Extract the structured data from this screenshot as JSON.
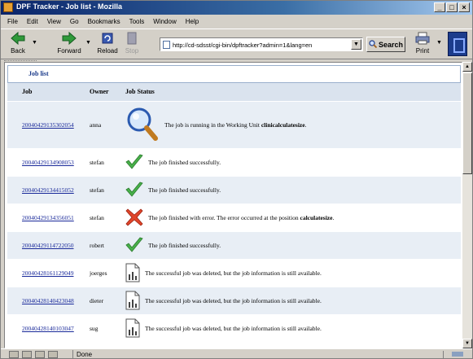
{
  "window": {
    "title": "DPF Tracker - Job list - Mozilla",
    "controls": [
      "_",
      "□",
      "×"
    ]
  },
  "menu": [
    "File",
    "Edit",
    "View",
    "Go",
    "Bookmarks",
    "Tools",
    "Window",
    "Help"
  ],
  "toolbar": {
    "back": "Back",
    "forward": "Forward",
    "reload": "Reload",
    "stop": "Stop",
    "url": "http://cd-sdsst/cgi-bin/dpftracker?admin=1&lang=en",
    "search": "Search",
    "print": "Print"
  },
  "page": {
    "heading": "Job list",
    "columns": {
      "job": "Job",
      "owner": "Owner",
      "status": "Job Status"
    },
    "jobs": [
      {
        "id": "20040429135302054",
        "owner": "anna",
        "icon": "magnifier-icon",
        "text": "The job is running in the Working Unit ",
        "bold": "clinicalculatesize",
        "tail": "."
      },
      {
        "id": "20040429134908053",
        "owner": "stefan",
        "icon": "checkmark-icon",
        "text": "The job finished successfully.",
        "bold": "",
        "tail": ""
      },
      {
        "id": "20040429134415052",
        "owner": "stefan",
        "icon": "checkmark-icon",
        "text": "The job finished successfully.",
        "bold": "",
        "tail": ""
      },
      {
        "id": "20040429134356051",
        "owner": "stefan",
        "icon": "error-x-icon",
        "text": "The job finished with error. The error occurred at the position ",
        "bold": "calculatesize",
        "tail": "."
      },
      {
        "id": "20040429114722050",
        "owner": "robert",
        "icon": "checkmark-icon",
        "text": "The job finished successfully.",
        "bold": "",
        "tail": ""
      },
      {
        "id": "20040428161129049",
        "owner": "joerges",
        "icon": "document-icon",
        "text": "The successful job was deleted, but the job information is still available.",
        "bold": "",
        "tail": ""
      },
      {
        "id": "20040428140423048",
        "owner": "dieter",
        "icon": "document-icon",
        "text": "The successful job was deleted, but the job information is still available.",
        "bold": "",
        "tail": ""
      },
      {
        "id": "20040428140103047",
        "owner": "sug",
        "icon": "document-icon",
        "text": "The successful job was deleted, but the job information is still available.",
        "bold": "",
        "tail": ""
      }
    ]
  },
  "statusbar": {
    "text": "Done"
  },
  "colors": {
    "link": "#1a2a9a",
    "heading": "#1a3a8a",
    "row_alt": "#e8eef5",
    "header_bg": "#dae3ee"
  }
}
